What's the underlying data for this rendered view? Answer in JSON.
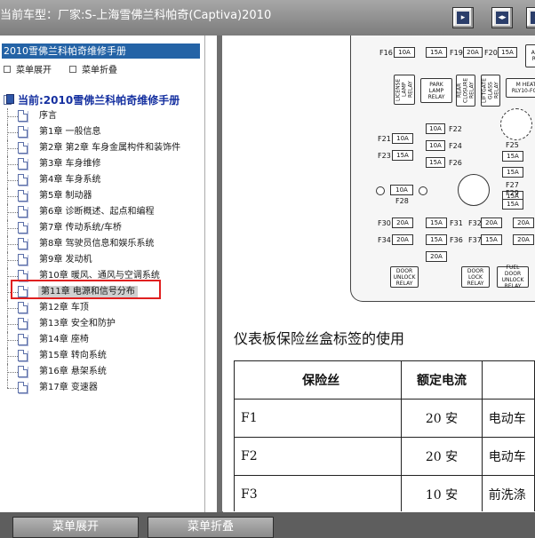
{
  "header": {
    "vehicle_title": "当前车型：厂家:S-上海雪佛兰科帕奇(Captiva)2010",
    "buttons": [
      {
        "name": "expand-tree-icon",
        "glyph": "▸"
      },
      {
        "name": "collapse-tree-icon",
        "glyph": "◂▸"
      },
      {
        "name": "sync-toc-icon",
        "glyph": "◂"
      }
    ]
  },
  "sidebar": {
    "manual_title": "2010雪佛兰科帕奇维修手册",
    "expand_label": "菜单展开",
    "collapse_label": "菜单折叠",
    "current_label": "当前:2010雪佛兰科帕奇维修手册",
    "items": [
      {
        "label": "序言"
      },
      {
        "label": "第1章  一般信息"
      },
      {
        "label": "第2章  第2章  车身金属构件和装饰件"
      },
      {
        "label": "第3章  车身维修"
      },
      {
        "label": "第4章  车身系统"
      },
      {
        "label": "第5章  制动器"
      },
      {
        "label": "第6章  诊断概述、起点和编程"
      },
      {
        "label": "第7章  传动系统/车桥"
      },
      {
        "label": "第8章  驾驶员信息和娱乐系统"
      },
      {
        "label": "第9章  发动机"
      },
      {
        "label": "第10章  暖风、通风与空调系统"
      },
      {
        "label": "第11章  电源和信号分布"
      },
      {
        "label": "第12章  车顶"
      },
      {
        "label": "第13章  安全和防护"
      },
      {
        "label": "第14章  座椅"
      },
      {
        "label": "第15章  转向系统"
      },
      {
        "label": "第16章  悬架系统"
      },
      {
        "label": "第17章  变速器"
      }
    ],
    "selected_index": 11
  },
  "diagram": {
    "fuses": [
      "10A",
      "15A",
      "20A",
      "15A",
      "10A",
      "10A",
      "10A",
      "15A",
      "15A",
      "10A",
      "15A",
      "15A",
      "15A",
      "15A",
      "10A",
      "20A",
      "15A",
      "20A",
      "20A",
      "20A",
      "15A",
      "15A",
      "20A",
      "15A",
      "15A",
      "20A"
    ],
    "fuse_labels": [
      "F16",
      "F19",
      "F20",
      "F21",
      "F22",
      "F24",
      "F23",
      "F26",
      "F25",
      "F27",
      "F29",
      "F28",
      "F30",
      "F31",
      "F32",
      "F34",
      "F35",
      "F36",
      "F37"
    ],
    "relays": [
      "LICENSE LAMP RELAY",
      "PARK LAMP RELAY",
      "REAR CLOSURE RELAY",
      "LIFTGATE GLASS RELAY",
      "M HEAT RLY10-FCH",
      "DOOR UNLOCK RELAY",
      "DOOR LOCK RELAY",
      "FUEL DOOR UNLOCK RELAY",
      "ACC RLY"
    ]
  },
  "content": {
    "section_title": "仪表板保险丝盒标签的使用",
    "table": {
      "headers": [
        "保险丝",
        "额定电流",
        ""
      ],
      "rows": [
        {
          "fuse": "F1",
          "rating": "20 安",
          "usage": "电动车"
        },
        {
          "fuse": "F2",
          "rating": "20 安",
          "usage": "电动车"
        },
        {
          "fuse": "F3",
          "rating": "10 安",
          "usage": "前洗涤"
        }
      ]
    }
  },
  "footer": {
    "expand_button": "菜单展开",
    "collapse_button": "菜单折叠"
  }
}
